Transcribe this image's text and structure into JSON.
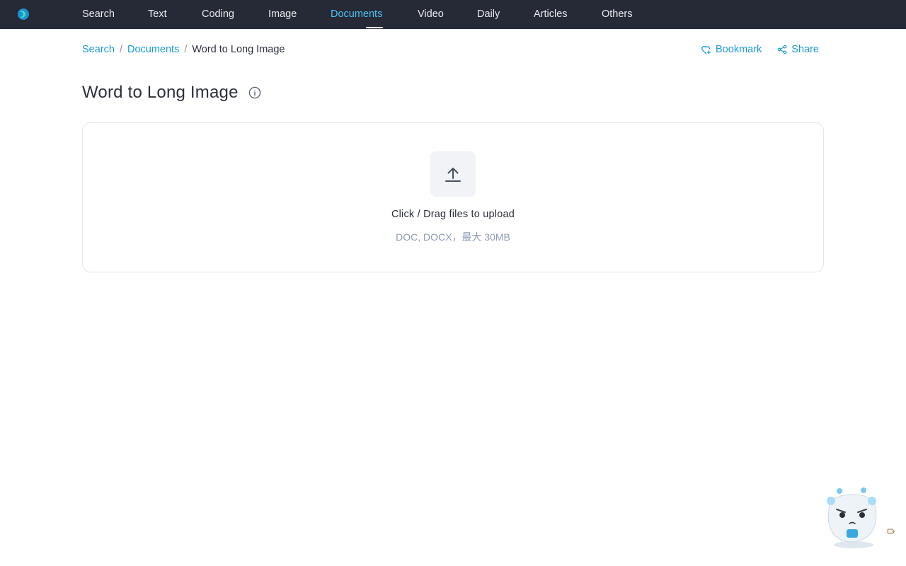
{
  "nav": {
    "items": [
      {
        "label": "Search",
        "active": false
      },
      {
        "label": "Text",
        "active": false
      },
      {
        "label": "Coding",
        "active": false
      },
      {
        "label": "Image",
        "active": false
      },
      {
        "label": "Documents",
        "active": true
      },
      {
        "label": "Video",
        "active": false
      },
      {
        "label": "Daily",
        "active": false
      },
      {
        "label": "Articles",
        "active": false
      },
      {
        "label": "Others",
        "active": false
      }
    ],
    "logo_icon": "app-logo-icon"
  },
  "breadcrumb": {
    "items": [
      "Search",
      "Documents"
    ],
    "separator": "/",
    "current": "Word to Long Image"
  },
  "actions": {
    "bookmark_label": "Bookmark",
    "bookmark_icon": "heart-plus-icon",
    "share_label": "Share",
    "share_icon": "share-icon"
  },
  "page": {
    "title": "Word to Long Image",
    "info_icon": "info-icon"
  },
  "upload": {
    "icon": "upload-icon",
    "text": "Click / Drag files to upload",
    "hint": "DOC, DOCX，最大 30MB"
  },
  "colors": {
    "nav_bg": "#252a36",
    "nav_active": "#4fc3f7",
    "link": "#1a9ad6",
    "hint": "#8e9bb0",
    "border": "#e3e6eb"
  },
  "assistant": {
    "icon": "mascot-assistant-icon"
  }
}
